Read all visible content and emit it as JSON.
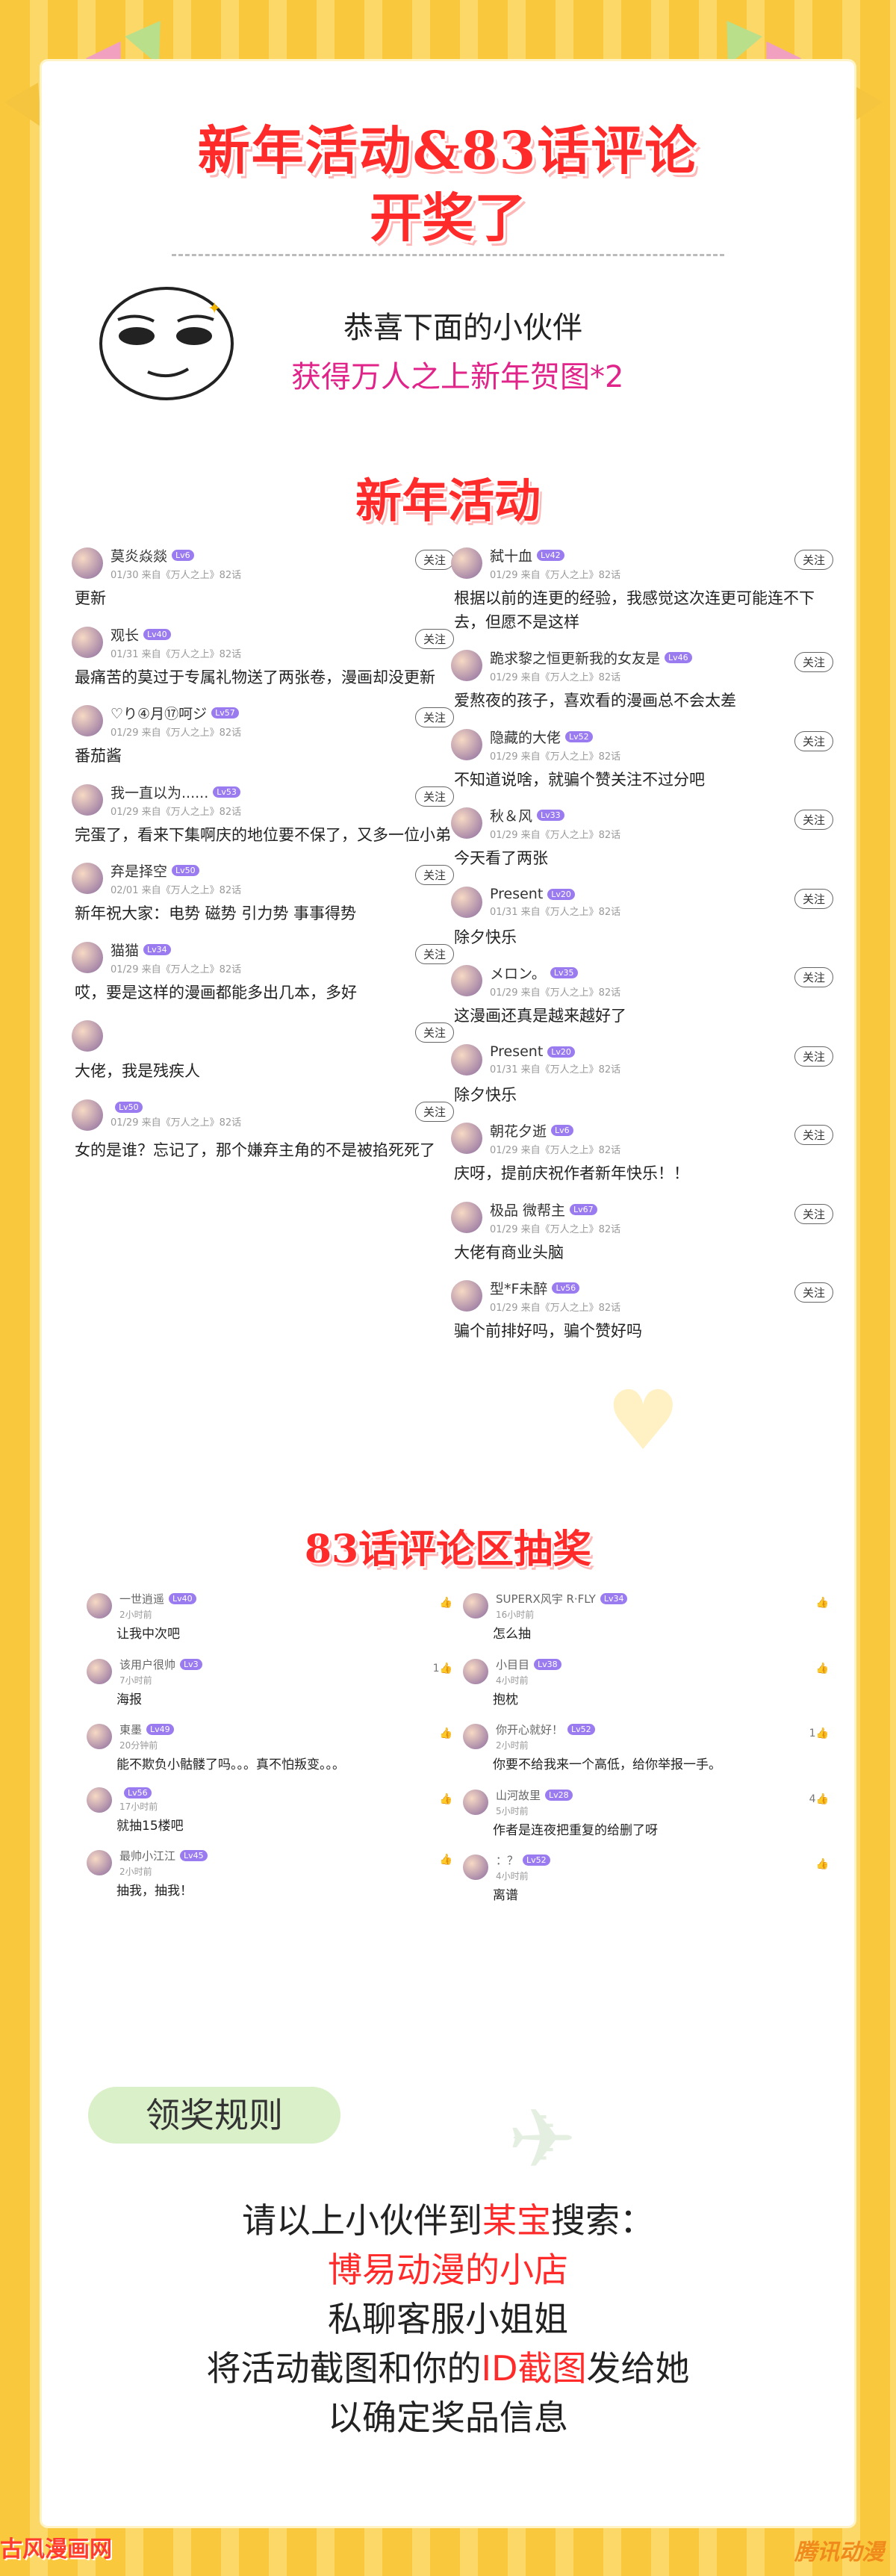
{
  "colors": {
    "accent_red": "#ff2a2a",
    "pink_text": "#e0248a",
    "background_yellow": "#f9c83c"
  },
  "title": {
    "line1": "新年活动&83话评论",
    "line2": "开奖了"
  },
  "intro": {
    "line1": "恭喜下面的小伙伴",
    "line2": "获得万人之上新年贺图*2"
  },
  "section1_title": "新年活动",
  "follow_label": "关注",
  "left_comments": [
    {
      "user": "莫炎焱燚",
      "level": "Lv6",
      "meta": "01/30 来自《万人之上》82话",
      "text": "更新"
    },
    {
      "user": "观长",
      "level": "Lv40",
      "meta": "01/31 来自《万人之上》82话",
      "text": "最痛苦的莫过于专属礼物送了两张卷，漫画却没更新"
    },
    {
      "user": "♡り④月⑰呵ジ",
      "level": "Lv57",
      "meta": "01/29 来自《万人之上》82话",
      "text": "番茄酱"
    },
    {
      "user": "我一直以为......",
      "level": "Lv53",
      "meta": "01/29 来自《万人之上》82话",
      "text": "完蛋了，看来下集啊庆的地位要不保了，又多一位小弟"
    },
    {
      "user": "弃是择空",
      "level": "Lv50",
      "meta": "02/01 来自《万人之上》82话",
      "text": "新年祝大家：电势 磁势 引力势 事事得势"
    },
    {
      "user": "猫猫",
      "level": "Lv34",
      "meta": "01/29 来自《万人之上》82话",
      "text": "哎，要是这样的漫画都能多出几本，多好"
    },
    {
      "user": "",
      "level": "",
      "meta": "",
      "text": "大佬，我是残疾人"
    },
    {
      "user": "",
      "level": "Lv50",
      "meta": "01/29 来自《万人之上》82话",
      "text": "女的是谁？忘记了，那个嫌弃主角的不是被掐死死了"
    }
  ],
  "right_comments": [
    {
      "user": "弑十血",
      "level": "Lv42",
      "meta": "01/29 来自《万人之上》82话",
      "text": "根据以前的连更的经验，我感觉这次连更可能连不下去，但愿不是这样"
    },
    {
      "user": "跪求黎之恒更新我的女友是",
      "level": "Lv46",
      "meta": "01/29 来自《万人之上》82话",
      "text": "爱熬夜的孩子，喜欢看的漫画总不会太差"
    },
    {
      "user": "隐藏的大佬",
      "level": "Lv52",
      "meta": "01/29 来自《万人之上》82话",
      "text": "不知道说啥，就骗个赞关注不过分吧"
    },
    {
      "user": "秋＆风",
      "level": "Lv33",
      "meta": "01/29 来自《万人之上》82话",
      "text": "今天看了两张"
    },
    {
      "user": "Present",
      "level": "Lv20",
      "meta": "01/31 来自《万人之上》82话",
      "text": "除夕快乐"
    },
    {
      "user": "メロン。",
      "level": "Lv35",
      "meta": "01/29 来自《万人之上》82话",
      "text": "这漫画还真是越来越好了"
    },
    {
      "user": "Present",
      "level": "Lv20",
      "meta": "01/31 来自《万人之上》82话",
      "text": "除夕快乐"
    },
    {
      "user": "朝花夕逝",
      "level": "Lv6",
      "meta": "01/29 来自《万人之上》82话",
      "text": "庆呀，提前庆祝作者新年快乐！！"
    },
    {
      "user": "极品 微帮主",
      "level": "Lv67",
      "meta": "01/29 来自《万人之上》82话",
      "text": "大佬有商业头脑"
    },
    {
      "user": "型*F未醉",
      "level": "Lv56",
      "meta": "01/29 来自《万人之上》82话",
      "text": "骗个前排好吗，骗个赞好吗"
    }
  ],
  "section2_title": "83话评论区抽奖",
  "lottery_left": [
    {
      "user": "一世逍遥",
      "level": "Lv40",
      "meta": "2小时前",
      "text": "让我中次吧",
      "likes": ""
    },
    {
      "user": "该用户很帅",
      "level": "Lv3",
      "meta": "7小时前",
      "text": "海报",
      "likes": "1"
    },
    {
      "user": "東墨",
      "level": "Lv49",
      "meta": "20分钟前",
      "text": "能不欺负小骷髅了吗。。。真不怕叛变。。。",
      "likes": ""
    },
    {
      "user": "",
      "level": "Lv56",
      "meta": "17小时前",
      "text": "就抽15楼吧",
      "likes": ""
    },
    {
      "user": "最帅小江江",
      "level": "Lv45",
      "meta": "2小时前",
      "text": "抽我，抽我！",
      "likes": ""
    }
  ],
  "lottery_right": [
    {
      "user": "SUPERX风宇 R·FLY",
      "level": "Lv34",
      "meta": "16小时前",
      "text": "怎么抽",
      "likes": ""
    },
    {
      "user": "小目目",
      "level": "Lv38",
      "meta": "4小时前",
      "text": "抱枕",
      "likes": ""
    },
    {
      "user": "你开心就好！",
      "level": "Lv52",
      "meta": "2小时前",
      "text": "你要不给我来一个高低，给你举报一手。",
      "likes": "1"
    },
    {
      "user": "山河故里",
      "level": "Lv28",
      "meta": "5小时前",
      "text": "作者是连夜把重复的给删了呀",
      "likes": "4"
    },
    {
      "user": "：？",
      "level": "Lv52",
      "meta": "4小时前",
      "text": "离谱",
      "likes": ""
    }
  ],
  "rules": {
    "badge": "领奖规则",
    "line1_a": "请以上小伙伴到",
    "line1_b": "某宝",
    "line1_c": "搜索：",
    "line2": "博易动漫的小店",
    "line3": "私聊客服小姐姐",
    "line4_a": "将活动截图和你的",
    "line4_b": "ID截图",
    "line4_c": "发给她",
    "line5": "以确定奖品信息"
  },
  "watermarks": {
    "left": "古风漫画网",
    "right": "腾讯动漫"
  }
}
